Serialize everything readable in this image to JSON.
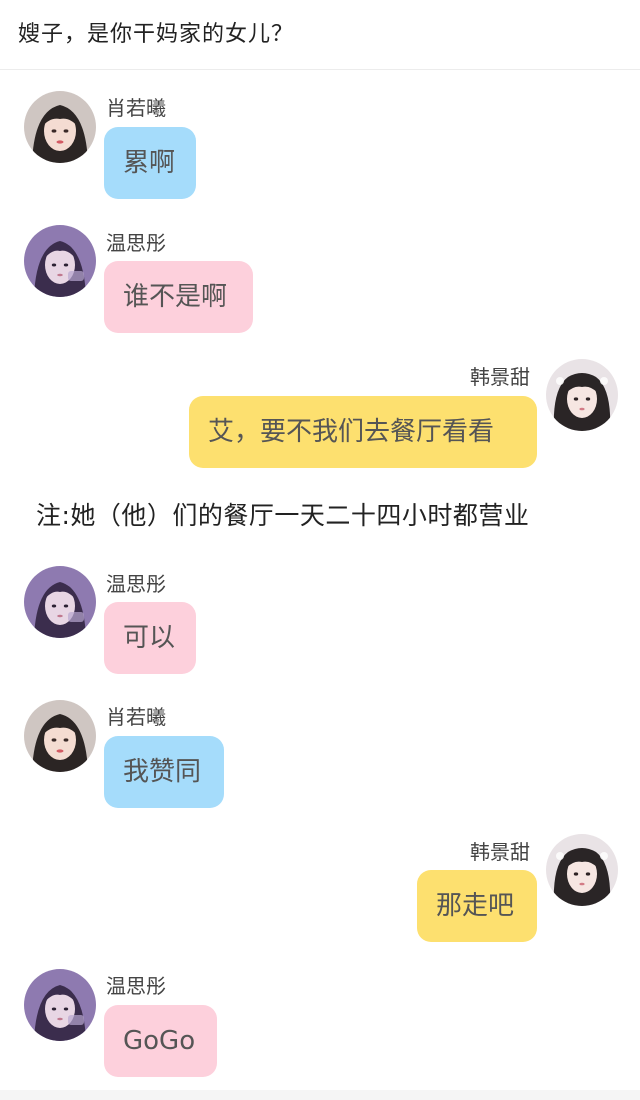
{
  "header": {
    "title": "嫂子，是你干妈家的女儿？"
  },
  "messages": [
    {
      "name": "肖若曦",
      "text": "累啊"
    },
    {
      "name": "温思彤",
      "text": "谁不是啊"
    },
    {
      "name": "韩景甜",
      "text": "艾，要不我们去餐厅看看"
    },
    {
      "name": "温思彤",
      "text": "可以"
    },
    {
      "name": "肖若曦",
      "text": "我赞同"
    },
    {
      "name": "韩景甜",
      "text": "那走吧"
    },
    {
      "name": "温思彤",
      "text": "GoGo"
    }
  ],
  "note": "注:她（他）们的餐厅一天二十四小时都营业",
  "colors": {
    "bubble_blue": "#a5dcfb",
    "bubble_pink": "#fdd0dc",
    "bubble_yellow": "#fde06f"
  },
  "avatars": {
    "肖若曦": "girl-portrait-avatar-dark-hair",
    "温思彤": "girl-portrait-avatar-purple",
    "韩景甜": "girl-portrait-avatar-twin-tails"
  }
}
